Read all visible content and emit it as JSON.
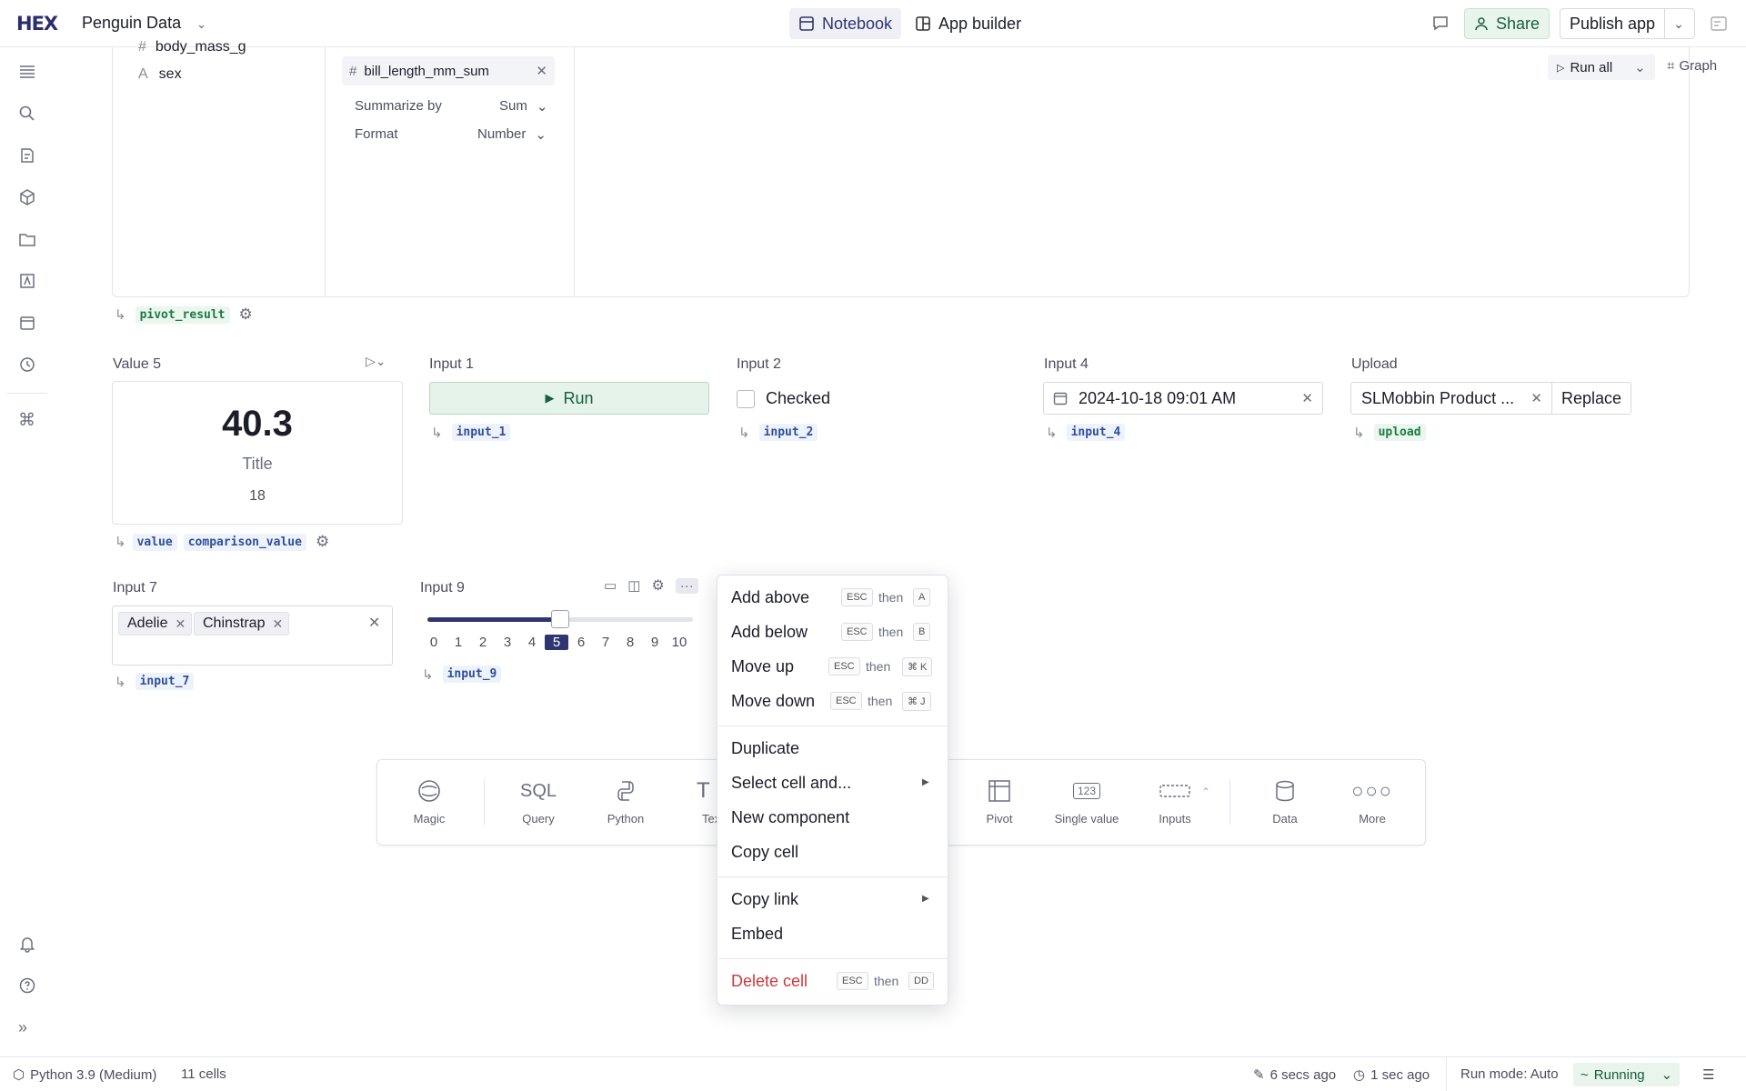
{
  "app": {
    "logo": "HEX",
    "project_name": "Penguin Data"
  },
  "topbar": {
    "notebook_tab": "Notebook",
    "app_builder_tab": "App builder",
    "share_label": "Share",
    "publish_label": "Publish app"
  },
  "pivot": {
    "fields": [
      "body_mass_g",
      "sex"
    ],
    "value_field": "bill_length_mm_sum",
    "summarize_label": "Summarize by",
    "summarize_value": "Sum",
    "format_label": "Format",
    "format_value": "Number",
    "run_all_label": "Run all",
    "graph_label": "Graph",
    "output_var": "pivot_result"
  },
  "cells": {
    "value5": {
      "label": "Value 5",
      "value": "40.3",
      "title": "Title",
      "comparison": "18",
      "vars": [
        "value",
        "comparison_value"
      ]
    },
    "input1": {
      "label": "Input 1",
      "button": "Run",
      "var": "input_1"
    },
    "input2": {
      "label": "Input 2",
      "checkbox_label": "Checked",
      "var": "input_2"
    },
    "input4": {
      "label": "Input 4",
      "value": "2024-10-18 09:01 AM",
      "var": "input_4"
    },
    "upload": {
      "label": "Upload",
      "file": "SLMobbin Product ...",
      "replace_label": "Replace",
      "var": "upload"
    },
    "input7": {
      "label": "Input 7",
      "chips": [
        "Adelie",
        "Chinstrap"
      ],
      "var": "input_7"
    },
    "input9": {
      "label": "Input 9",
      "ticks": [
        "0",
        "1",
        "2",
        "3",
        "4",
        "5",
        "6",
        "7",
        "8",
        "9",
        "10"
      ],
      "selected": 5,
      "fraction": 0.5,
      "var": "input_9"
    }
  },
  "toolbar": {
    "items": [
      "Magic",
      "Query",
      "Python",
      "Text",
      "Pivot",
      "Single value",
      "Inputs",
      "Data",
      "More"
    ],
    "query_glyph": "SQL",
    "single_value_glyph": "123"
  },
  "context_menu": {
    "add_above": "Add above",
    "add_below": "Add below",
    "move_up": "Move up",
    "move_down": "Move down",
    "duplicate": "Duplicate",
    "select_cell": "Select cell and...",
    "new_component": "New component",
    "copy_cell": "Copy cell",
    "copy_link": "Copy link",
    "embed": "Embed",
    "delete_cell": "Delete cell",
    "esc": "ESC",
    "then": "then",
    "key_a": "A",
    "key_b": "B",
    "key_k": "⌘ K",
    "key_j": "⌘ J",
    "key_dd": "DD"
  },
  "statusbar": {
    "kernel": "Python 3.9 (Medium)",
    "cells": "11 cells",
    "edited": "6 secs ago",
    "ran": "1 sec ago",
    "run_mode": "Run mode: Auto",
    "status": "Running"
  },
  "colors": {
    "brand": "#2b2d6e",
    "accent": "#2f3570",
    "success": "#17603a",
    "danger": "#c93a3a"
  }
}
